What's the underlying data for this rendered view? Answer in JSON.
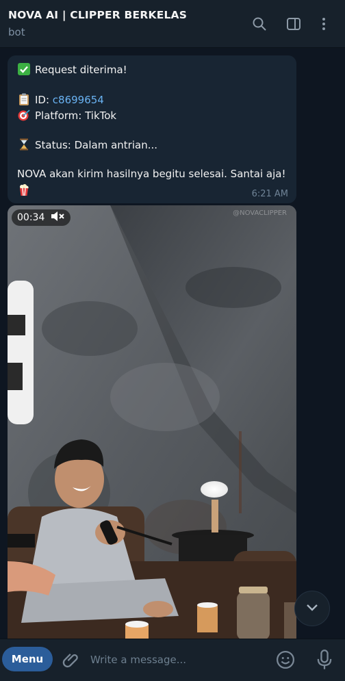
{
  "header": {
    "title": "NOVA AI | CLIPPER BERKELAS",
    "subtitle": "bot",
    "icons": [
      "search-icon",
      "sidebar-toggle-icon",
      "more-vertical-icon"
    ]
  },
  "message": {
    "line1": "Request diterima!",
    "id_label": "ID: ",
    "id_value": "c8699654",
    "platform": "Platform: TikTok",
    "status": "Status: Dalam antrian...",
    "body": "NOVA akan kirim hasilnya begitu selesai. Santai aja!",
    "time": "6:21 AM",
    "emojis": [
      "check-mark-icon",
      "clipboard-icon",
      "dart-icon",
      "hourglass-icon",
      "popcorn-icon"
    ]
  },
  "video": {
    "duration": "00:34",
    "watermark": "@NOVACLIPPER",
    "muted_icon": "speaker-muted-icon"
  },
  "composer": {
    "menu_label": "Menu",
    "placeholder": "Write a message...",
    "icons": [
      "attach-icon",
      "emoji-icon",
      "microphone-icon"
    ]
  },
  "colors": {
    "background": "#0e1621",
    "header": "#17212b",
    "bubble": "#182533",
    "accent": "#2b5d9a",
    "link": "#6ab3f3"
  }
}
